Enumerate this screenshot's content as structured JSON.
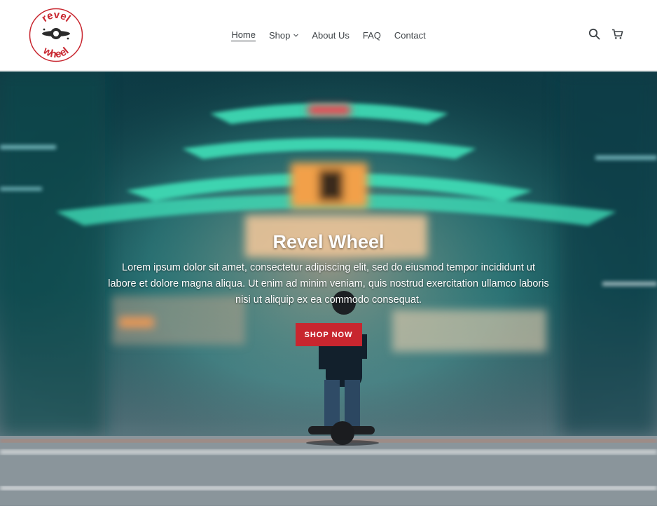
{
  "brand": {
    "logo_text_top": "revel",
    "logo_text_bottom": "wheel",
    "logo_color": "#c8262f"
  },
  "nav": {
    "items": [
      {
        "label": "Home",
        "active": true
      },
      {
        "label": "Shop",
        "has_dropdown": true
      },
      {
        "label": "About Us"
      },
      {
        "label": "FAQ"
      },
      {
        "label": "Contact"
      }
    ]
  },
  "header_icons": {
    "search": "search-icon",
    "cart": "cart-icon"
  },
  "hero": {
    "title": "Revel Wheel",
    "text": "Lorem ipsum dolor sit amet, consectetur adipiscing elit, sed do eiusmod tempor incididunt ut labore et dolore magna aliqua. Ut enim ad minim veniam, quis nostrud exercitation ullamco laboris nisi ut aliquip ex ea commodo consequat.",
    "button_label": "SHOP NOW",
    "button_color": "#c8262f"
  }
}
